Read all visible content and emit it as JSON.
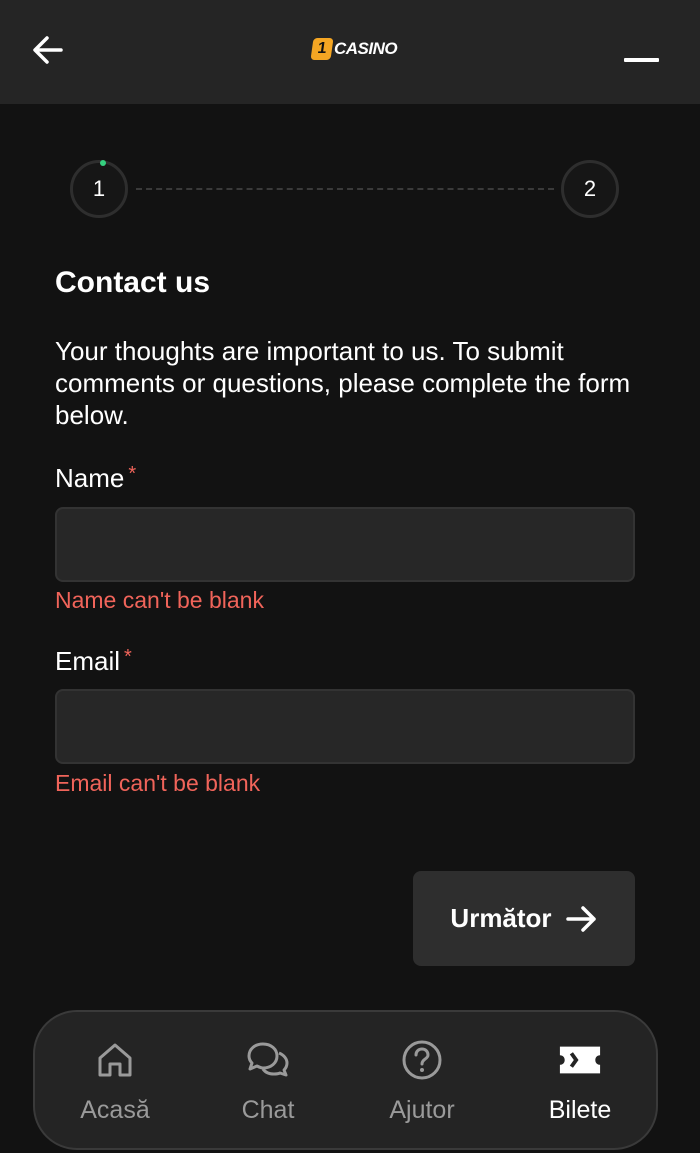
{
  "header": {
    "logo_badge": "1",
    "logo_text": "CASINO"
  },
  "stepper": {
    "steps": [
      "1",
      "2"
    ],
    "current": 1
  },
  "form": {
    "title": "Contact us",
    "description": "Your thoughts are important to us. To submit comments or questions, please complete the form below.",
    "fields": [
      {
        "label": "Name",
        "required_mark": "*",
        "value": "",
        "placeholder": "",
        "error": "Name can't be blank"
      },
      {
        "label": "Email",
        "required_mark": "*",
        "value": "",
        "placeholder": "",
        "error": "Email can't be blank"
      }
    ],
    "next_label": "Următor"
  },
  "bottom_nav": {
    "items": [
      {
        "label": "Acasă",
        "icon": "home-icon",
        "active": false
      },
      {
        "label": "Chat",
        "icon": "chat-icon",
        "active": false
      },
      {
        "label": "Ajutor",
        "icon": "help-icon",
        "active": false
      },
      {
        "label": "Bilete",
        "icon": "ticket-icon",
        "active": true
      }
    ]
  },
  "colors": {
    "background": "#121212",
    "header": "#252525",
    "error": "#f0645a",
    "step_indicator": "#35d07f",
    "logo_badge": "#f5a623"
  }
}
